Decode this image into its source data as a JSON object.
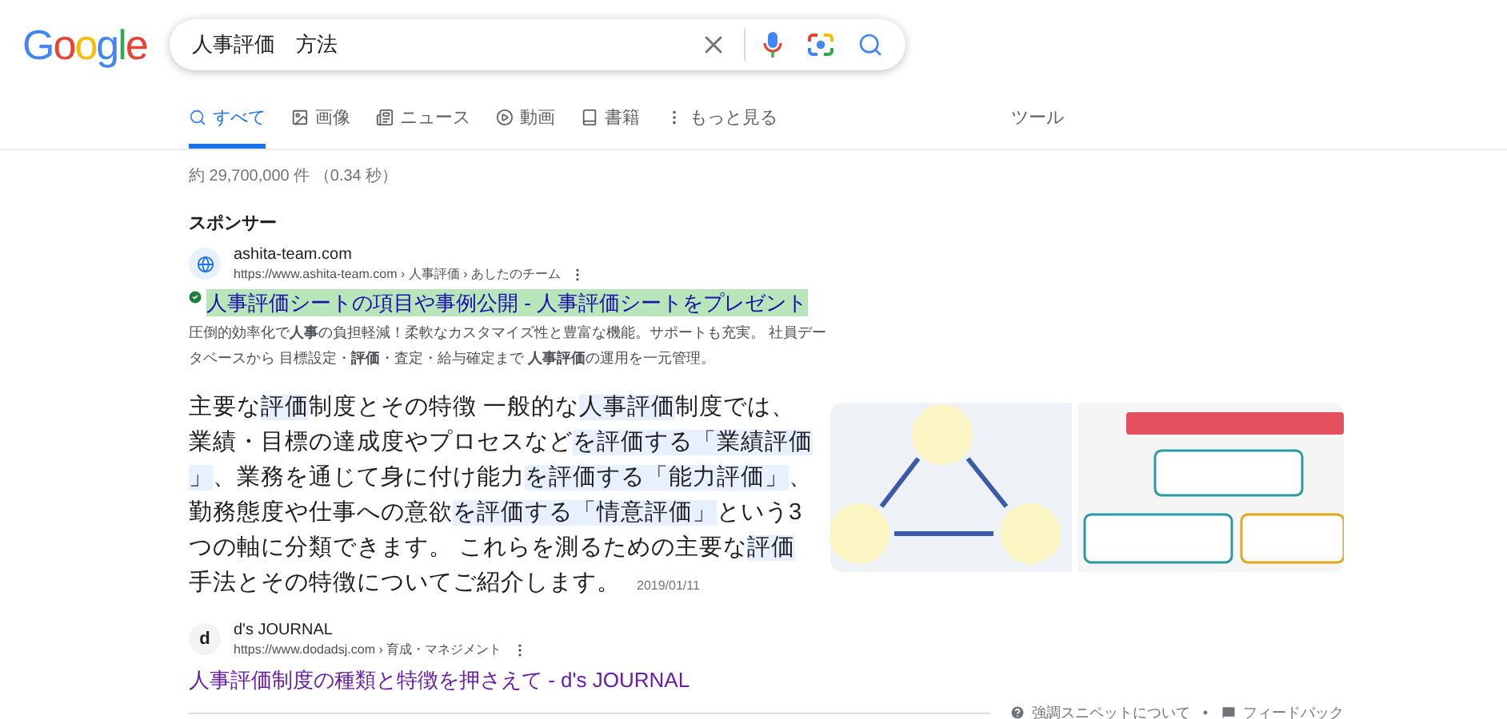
{
  "logo": "Google",
  "search": {
    "value": "人事評価　方法"
  },
  "tabs": [
    {
      "label": "すべて",
      "selected": true
    },
    {
      "label": "画像",
      "selected": false
    },
    {
      "label": "ニュース",
      "selected": false
    },
    {
      "label": "動画",
      "selected": false
    },
    {
      "label": "書籍",
      "selected": false
    },
    {
      "label": "もっと見る",
      "selected": false
    }
  ],
  "tools": "ツール",
  "result_stats": "約 29,700,000 件 （0.34 秒）",
  "ad": {
    "label": "スポンサー",
    "site": "ashita-team.com",
    "url": "https://www.ashita-team.com › 人事評価 › あしたのチーム",
    "title": "人事評価シートの項目や事例公開 - 人事評価シートをプレゼント",
    "highlighted": true,
    "description": "圧倒的効率化で**人事**の負担軽減！柔軟なカスタマイズ性と豊富な機能。サポートも充実。 社員データベースから 目標設定・**評価**・査定・給与確定まで **人事評価**の運用を一元管理。"
  },
  "snippet": {
    "segments": [
      {
        "text": "主要な",
        "highlighted": false
      },
      {
        "text": "評価",
        "highlighted": true
      },
      {
        "text": "制度とその特徴 一般的な",
        "highlighted": false
      },
      {
        "text": "人事評価",
        "highlighted": true
      },
      {
        "text": "制度では、業績・目標の達成度やプロセスなど",
        "highlighted": false
      },
      {
        "text": "を評価する「業績評価」",
        "highlighted": true
      },
      {
        "text": "、業務を通じて身に付け能力",
        "highlighted": false
      },
      {
        "text": "を評価する「能力評価」",
        "highlighted": true
      },
      {
        "text": "、勤務態度や仕事への意欲",
        "highlighted": false
      },
      {
        "text": "を評価する「情意評価」",
        "highlighted": true
      },
      {
        "text": "という3つの軸に分類できます。 これらを測るための主要な",
        "highlighted": false
      },
      {
        "text": "評価",
        "highlighted": true
      },
      {
        "text": "手法とその特徴についてご紹介します。",
        "highlighted": false
      }
    ],
    "date": "2019/01/11",
    "source": {
      "site": "d's JOURNAL",
      "url": "https://www.dodadsj.com › 育成・マネジメント",
      "title": "人事評価制度の種類と特徴を押さえて - d's JOURNAL",
      "favicon": "d"
    }
  },
  "footer": {
    "about": "強調スニペットについて",
    "separator": "•",
    "feedback": "フィードバック"
  }
}
